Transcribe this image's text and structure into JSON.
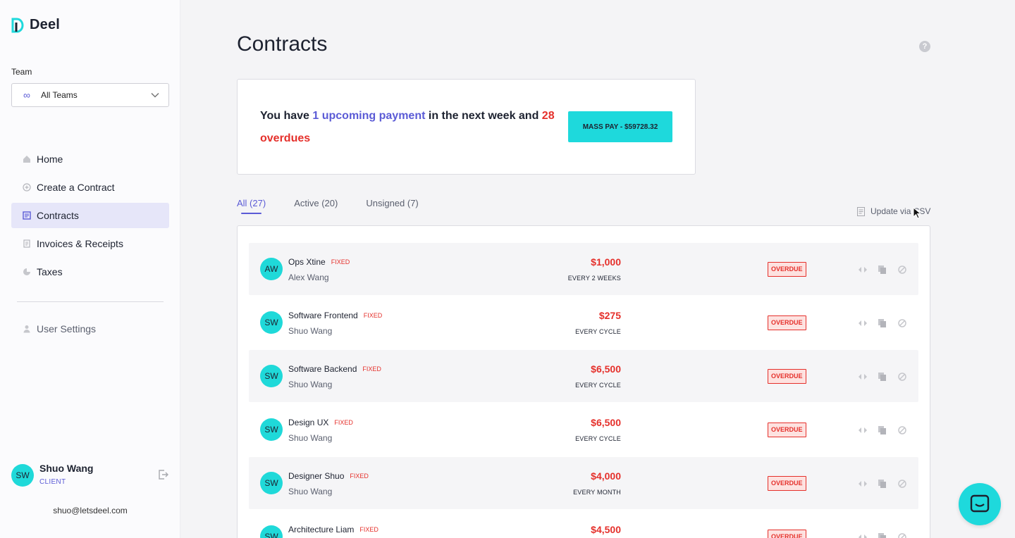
{
  "brand": {
    "name": "Deel"
  },
  "team": {
    "label": "Team",
    "selected": "All Teams"
  },
  "nav": {
    "items": [
      {
        "label": "Home",
        "icon": "home-icon"
      },
      {
        "label": "Create a Contract",
        "icon": "plus-circle-icon"
      },
      {
        "label": "Contracts",
        "icon": "contracts-icon",
        "active": true
      },
      {
        "label": "Invoices & Receipts",
        "icon": "receipt-icon"
      },
      {
        "label": "Taxes",
        "icon": "pie-chart-icon"
      }
    ],
    "settings_label": "User Settings"
  },
  "user": {
    "initials": "SW",
    "name": "Shuo Wang",
    "role": "CLIENT",
    "email": "shuo@letsdeel.com"
  },
  "page": {
    "title": "Contracts",
    "help": "?"
  },
  "payment_notice": {
    "prefix": "You have ",
    "upcoming": "1 upcoming payment",
    "middle": " in the next week and ",
    "overdue": "28 overdues",
    "button": "MASS PAY - $59728.32"
  },
  "tabs": [
    {
      "label": "All (27)",
      "active": true
    },
    {
      "label": "Active (20)"
    },
    {
      "label": "Unsigned (7)"
    }
  ],
  "csv_label": "Update via CSV",
  "contracts": [
    {
      "initials": "AW",
      "title": "Ops Xtine",
      "type": "FIXED",
      "person": "Alex Wang",
      "amount": "$1,000",
      "frequency": "EVERY 2 WEEKS",
      "status": "OVERDUE"
    },
    {
      "initials": "SW",
      "title": "Software Frontend",
      "type": "FIXED",
      "person": "Shuo Wang",
      "amount": "$275",
      "frequency": "EVERY CYCLE",
      "status": "OVERDUE"
    },
    {
      "initials": "SW",
      "title": "Software Backend",
      "type": "FIXED",
      "person": "Shuo Wang",
      "amount": "$6,500",
      "frequency": "EVERY CYCLE",
      "status": "OVERDUE"
    },
    {
      "initials": "SW",
      "title": "Design UX",
      "type": "FIXED",
      "person": "Shuo Wang",
      "amount": "$6,500",
      "frequency": "EVERY CYCLE",
      "status": "OVERDUE"
    },
    {
      "initials": "SW",
      "title": "Designer Shuo",
      "type": "FIXED",
      "person": "Shuo Wang",
      "amount": "$4,000",
      "frequency": "EVERY MONTH",
      "status": "OVERDUE"
    },
    {
      "initials": "SW",
      "title": "Architecture Liam",
      "type": "FIXED",
      "person": "",
      "amount": "$4,500",
      "frequency": "",
      "status": "OVERDUE"
    }
  ],
  "colors": {
    "accent": "#5b5bd6",
    "teal": "#1ed9dc",
    "overdue": "#e5302b"
  }
}
